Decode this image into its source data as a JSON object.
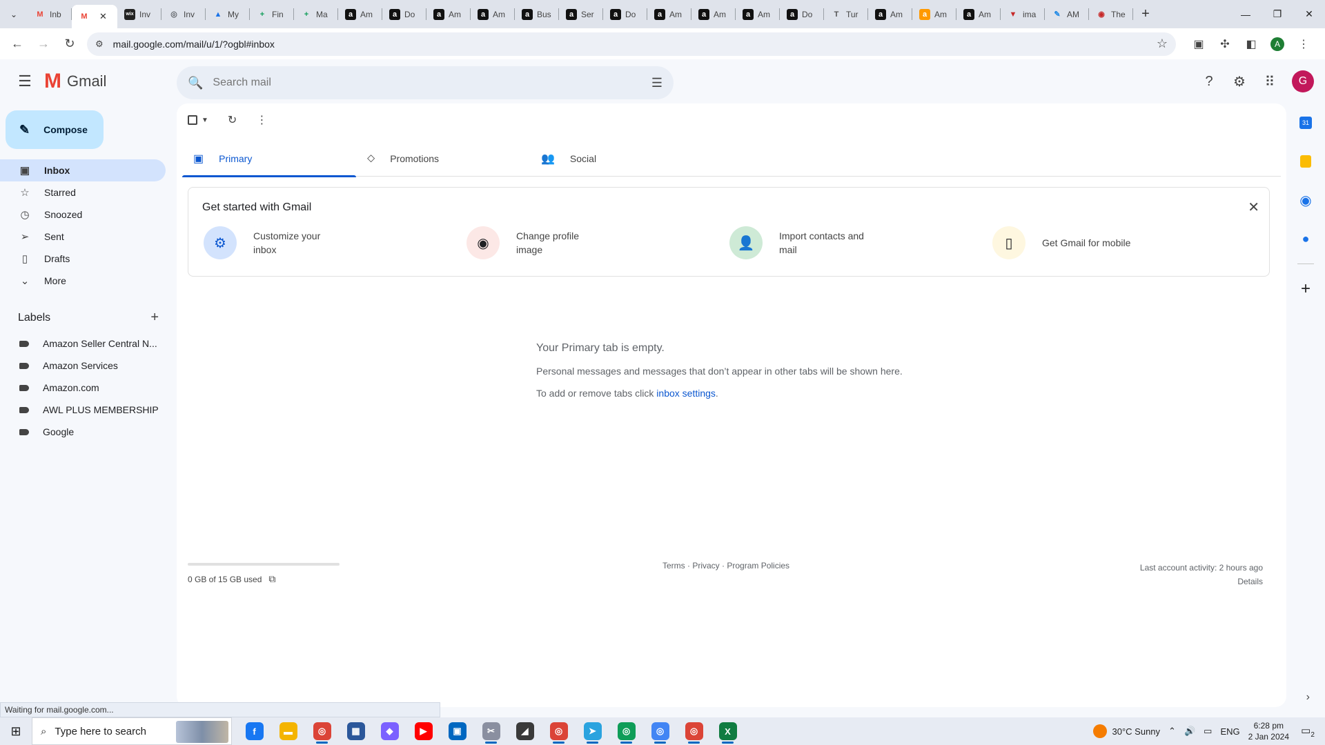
{
  "browser": {
    "tabs": [
      {
        "label": "Inb",
        "icon": "gmail-icon",
        "color": "#ea4335",
        "glyph": "M"
      },
      {
        "label": "",
        "icon": "gmail-icon",
        "color": "#ea4335",
        "glyph": "M",
        "active": true
      },
      {
        "label": "Inv",
        "icon": "wix-icon",
        "color": "#222222",
        "glyph": "wix"
      },
      {
        "label": "Inv",
        "icon": "globe-icon",
        "color": "#5f6368",
        "glyph": "◎"
      },
      {
        "label": "My",
        "icon": "drive-icon",
        "color": "#1a73e8",
        "glyph": "▲"
      },
      {
        "label": "Fin",
        "icon": "sheets-icon",
        "color": "#0f9d58",
        "glyph": "+"
      },
      {
        "label": "Ma",
        "icon": "sheets-icon",
        "color": "#0f9d58",
        "glyph": "+"
      },
      {
        "label": "Am",
        "icon": "amazon-icon",
        "color": "#111111",
        "glyph": "a"
      },
      {
        "label": "Do",
        "icon": "amazon-icon",
        "color": "#111111",
        "glyph": "a"
      },
      {
        "label": "Am",
        "icon": "amazon-icon",
        "color": "#111111",
        "glyph": "a"
      },
      {
        "label": "Am",
        "icon": "amazon-icon",
        "color": "#111111",
        "glyph": "a"
      },
      {
        "label": "Bus",
        "icon": "amazon-icon",
        "color": "#111111",
        "glyph": "a"
      },
      {
        "label": "Ser",
        "icon": "amazon-icon",
        "color": "#111111",
        "glyph": "a"
      },
      {
        "label": "Do",
        "icon": "amazon-icon",
        "color": "#111111",
        "glyph": "a"
      },
      {
        "label": "Am",
        "icon": "amazon-icon",
        "color": "#111111",
        "glyph": "a"
      },
      {
        "label": "Am",
        "icon": "amazon-icon",
        "color": "#111111",
        "glyph": "a"
      },
      {
        "label": "Am",
        "icon": "amazon-icon",
        "color": "#111111",
        "glyph": "a"
      },
      {
        "label": "Do",
        "icon": "amazon-icon",
        "color": "#111111",
        "glyph": "a"
      },
      {
        "label": "Tur",
        "icon": "turnitin-icon",
        "color": "#555555",
        "glyph": "T"
      },
      {
        "label": "Am",
        "icon": "amazon-icon",
        "color": "#111111",
        "glyph": "a"
      },
      {
        "label": "Am",
        "icon": "amazon-icon",
        "color": "#ff9900",
        "glyph": "a"
      },
      {
        "label": "Am",
        "icon": "amazon-icon",
        "color": "#111111",
        "glyph": "a"
      },
      {
        "label": "ima",
        "icon": "site-icon",
        "color": "#c62828",
        "glyph": "▼"
      },
      {
        "label": "AM",
        "icon": "pen-icon",
        "color": "#1e88e5",
        "glyph": "✎"
      },
      {
        "label": "The",
        "icon": "site-icon",
        "color": "#c62828",
        "glyph": "◉"
      }
    ],
    "url": "mail.google.com/mail/u/1/?ogbl#inbox",
    "profile_letter": "A"
  },
  "gmail": {
    "logo_text": "Gmail",
    "search_placeholder": "Search mail",
    "avatar_letter": "G",
    "compose_label": "Compose",
    "nav": [
      {
        "label": "Inbox",
        "icon": "inbox-icon",
        "glyph": "▣",
        "active": true
      },
      {
        "label": "Starred",
        "icon": "star-icon",
        "glyph": "☆"
      },
      {
        "label": "Snoozed",
        "icon": "clock-icon",
        "glyph": "◷"
      },
      {
        "label": "Sent",
        "icon": "send-icon",
        "glyph": "➢"
      },
      {
        "label": "Drafts",
        "icon": "draft-icon",
        "glyph": "▯"
      },
      {
        "label": "More",
        "icon": "chevron-down-icon",
        "glyph": "⌄"
      }
    ],
    "labels_heading": "Labels",
    "labels": [
      "Amazon Seller Central N...",
      "Amazon Services",
      "Amazon.com",
      "AWL PLUS MEMBERSHIP",
      "Google"
    ],
    "inbox_tabs": [
      {
        "label": "Primary",
        "icon": "inbox-icon",
        "glyph": "▣",
        "active": true
      },
      {
        "label": "Promotions",
        "icon": "tag-icon",
        "glyph": "⬦"
      },
      {
        "label": "Social",
        "icon": "people-icon",
        "glyph": "👥"
      }
    ],
    "get_started": {
      "title": "Get started with Gmail",
      "items": [
        {
          "text": "Customize your inbox",
          "icon": "gear-icon",
          "glyph": "⚙",
          "bg": "#d3e3fd",
          "fg": "#0b57d0"
        },
        {
          "text": "Change profile image",
          "icon": "account-circle-icon",
          "glyph": "◉",
          "bg": "#fce8e6",
          "fg": "#202124"
        },
        {
          "text": "Import contacts and mail",
          "icon": "person-add-icon",
          "glyph": "👤",
          "bg": "#ceead6",
          "fg": "#202124"
        },
        {
          "text": "Get Gmail for mobile",
          "icon": "phone-icon",
          "glyph": "▯",
          "bg": "#fef7e0",
          "fg": "#202124"
        }
      ]
    },
    "empty": {
      "title": "Your Primary tab is empty.",
      "line1": "Personal messages and messages that don’t appear in other tabs will be shown here.",
      "line2_prefix": "To add or remove tabs click ",
      "line2_link": "inbox settings",
      "line2_suffix": "."
    },
    "storage": "0 GB of 15 GB used",
    "footer": {
      "terms": "Terms",
      "privacy": "Privacy",
      "policies": "Program Policies",
      "sep": " · "
    },
    "activity": {
      "line": "Last account activity: 2 hours ago",
      "details": "Details"
    },
    "status": "Waiting for mail.google.com..."
  },
  "taskbar": {
    "search_placeholder": "Type here to search",
    "apps": [
      {
        "icon": "facebook-icon",
        "color": "#1877f2",
        "glyph": "f"
      },
      {
        "icon": "file-explorer-icon",
        "color": "#f4b400",
        "glyph": "▬"
      },
      {
        "icon": "chrome-icon",
        "color": "#db4437",
        "glyph": "◎",
        "running": true
      },
      {
        "icon": "calculator-icon",
        "color": "#2b579a",
        "glyph": "▦"
      },
      {
        "icon": "copilot-icon",
        "color": "#7b61ff",
        "glyph": "◆"
      },
      {
        "icon": "youtube-icon",
        "color": "#ff0000",
        "glyph": "▶"
      },
      {
        "icon": "store-icon",
        "color": "#0067c0",
        "glyph": "▣"
      },
      {
        "icon": "snipping-icon",
        "color": "#8a8fa0",
        "glyph": "✂",
        "running": true
      },
      {
        "icon": "sticky-notes-icon",
        "color": "#3a3a3a",
        "glyph": "◢"
      },
      {
        "icon": "chrome-icon",
        "color": "#db4437",
        "glyph": "◎",
        "running": true
      },
      {
        "icon": "telegram-icon",
        "color": "#2aa3df",
        "glyph": "➤",
        "running": true
      },
      {
        "icon": "chrome-icon",
        "color": "#0f9d58",
        "glyph": "◎",
        "running": true
      },
      {
        "icon": "chrome-icon",
        "color": "#4285f4",
        "glyph": "◎",
        "running": true
      },
      {
        "icon": "chrome-icon",
        "color": "#db4437",
        "glyph": "◎",
        "running": true
      },
      {
        "icon": "excel-icon",
        "color": "#107c41",
        "glyph": "X",
        "running": true
      }
    ],
    "weather": "30°C  Sunny",
    "lang": "ENG",
    "time": "6:28 pm",
    "date": "2 Jan 2024",
    "notifications": "2"
  }
}
